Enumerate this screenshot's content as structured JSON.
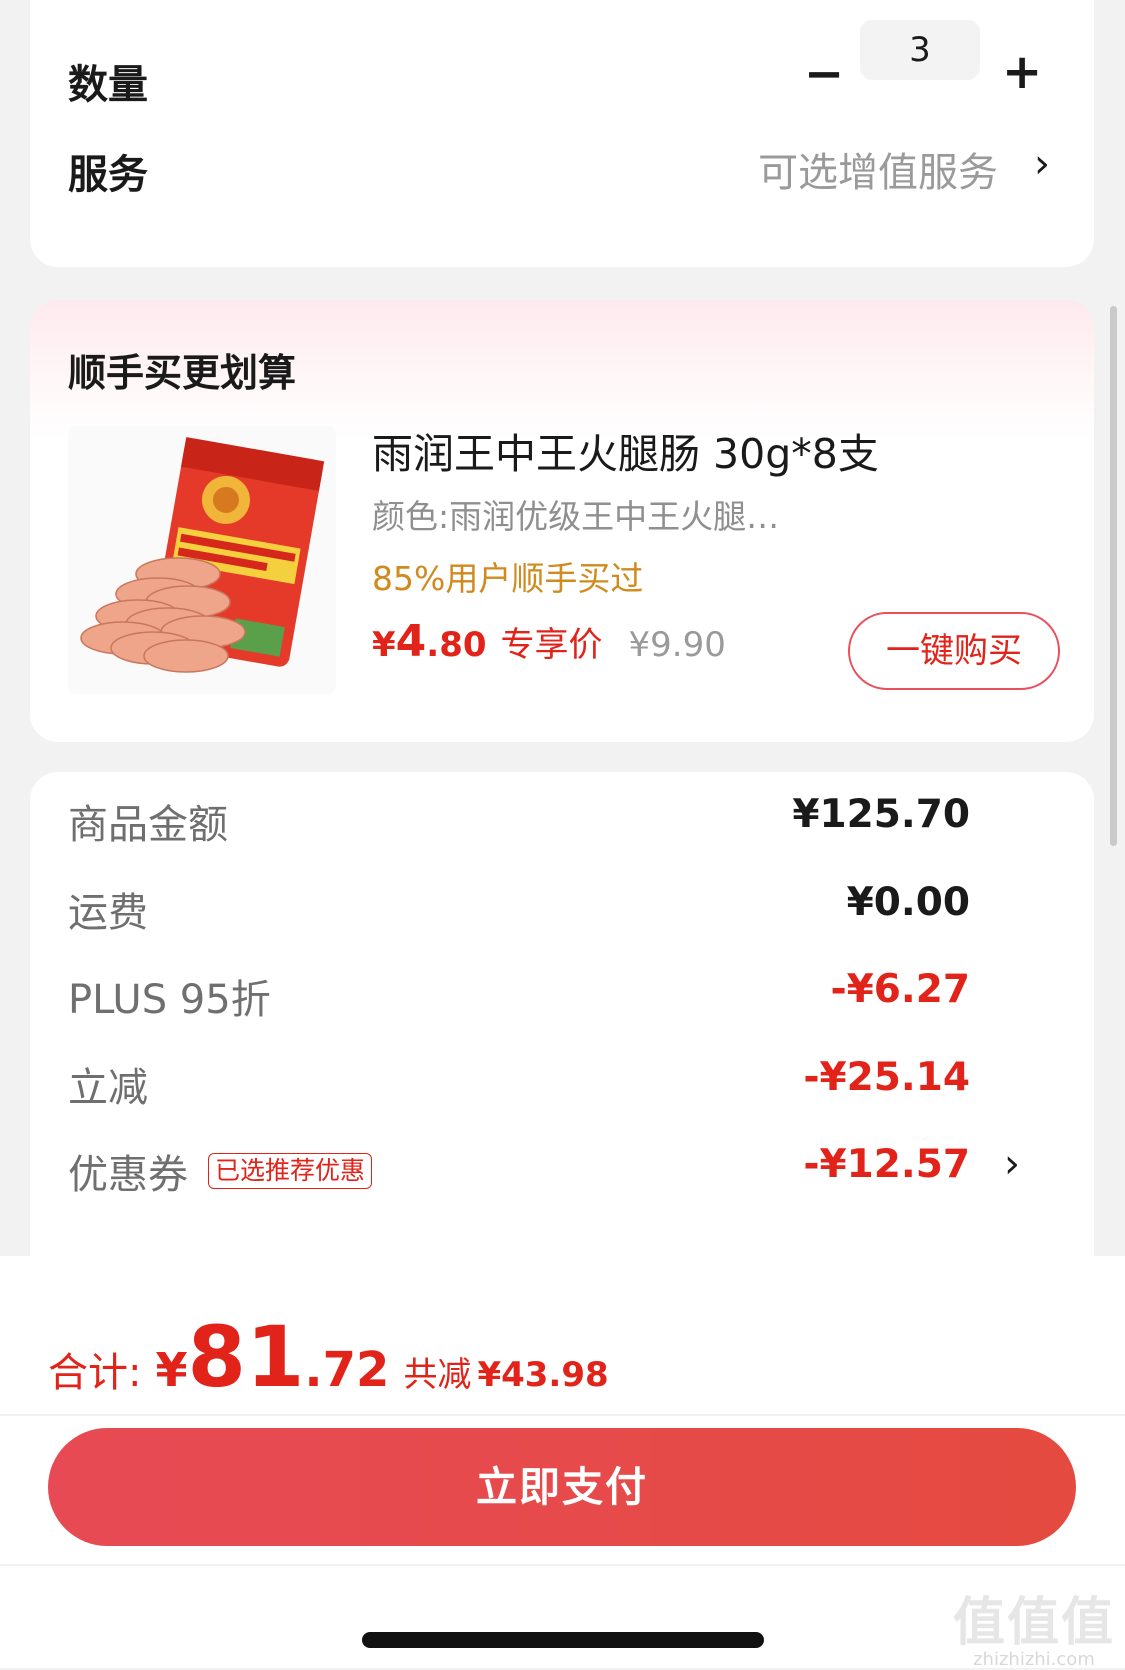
{
  "quantity": {
    "label": "数量",
    "minus": "−",
    "value": "3",
    "plus": "+"
  },
  "service": {
    "label": "服务",
    "value": "可选增值服务",
    "chevron": "›"
  },
  "recommend": {
    "title": "顺手买更划算",
    "product": {
      "name": "雨润王中王火腿肠 30g*8支",
      "spec": "颜色:雨润优级王中王火腿…",
      "bought": "85%用户顺手买过",
      "price_symbol": "¥",
      "price_int": "4",
      "price_dec": ".80",
      "price_tag": "专享价",
      "original_price": "¥9.90",
      "buy_label": "一键购买",
      "image_icon": "sausage-pack-image"
    }
  },
  "summary": {
    "rows": [
      {
        "label": "商品金额",
        "value": "¥125.70"
      },
      {
        "label": "运费",
        "value": "¥0.00"
      },
      {
        "label": "PLUS 95折",
        "value": "-¥6.27"
      },
      {
        "label": "立减",
        "value": "-¥25.14"
      },
      {
        "label": "优惠券",
        "badge": "已选推荐优惠",
        "value": "-¥12.57",
        "chevron": "›"
      }
    ]
  },
  "footer": {
    "total_label": "合计:",
    "total_symbol": "¥",
    "total_int": "81",
    "total_dec": ".72",
    "save_label": "共减",
    "save_value": "¥43.98",
    "pay_label": "立即支付"
  },
  "watermark": {
    "mark": "值值值",
    "site": "zhizhizhi.com"
  },
  "colors": {
    "accent": "#e2231a",
    "pay_button": "#e84a55",
    "bought": "#d08a1e"
  }
}
